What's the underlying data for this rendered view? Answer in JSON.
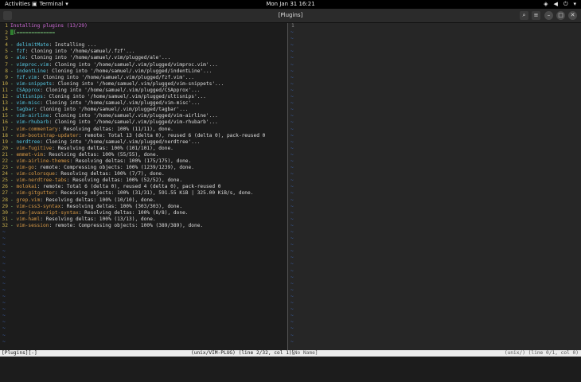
{
  "topbar": {
    "activities": "Activities",
    "app_name": "Terminal",
    "clock": "Mon Jan 31  16:21"
  },
  "window": {
    "title": "[Plugins]"
  },
  "left_pane": {
    "header": "Installing plugins (13/29)",
    "progress": "[=============",
    "lines": [
      {
        "n": "4",
        "name": "delimitMate",
        "text": ": Installing ..."
      },
      {
        "n": "5",
        "name": "fzf",
        "text": ": Cloning into '/home/samuel/.fzf'..."
      },
      {
        "n": "6",
        "name": "ale",
        "text": ": Cloning into '/home/samuel/.vim/plugged/ale'..."
      },
      {
        "n": "7",
        "name": "vimproc.vim",
        "text": ": Cloning into '/home/samuel/.vim/plugged/vimproc.vim'..."
      },
      {
        "n": "8",
        "name": "indentLine",
        "text": ": Cloning into '/home/samuel/.vim/plugged/indentLine'..."
      },
      {
        "n": "9",
        "name": "fzf.vim",
        "text": ": Cloning into '/home/samuel/.vim/plugged/fzf.vim'..."
      },
      {
        "n": "10",
        "name": "vim-snippets",
        "text": ": Cloning into '/home/samuel/.vim/plugged/vim-snippets'..."
      },
      {
        "n": "11",
        "name": "CSApprox",
        "text": ": Cloning into '/home/samuel/.vim/plugged/CSApprox'..."
      },
      {
        "n": "12",
        "name": "ultisnips",
        "text": ": Cloning into '/home/samuel/.vim/plugged/ultisnips'..."
      },
      {
        "n": "13",
        "name": "vim-misc",
        "text": ": Cloning into '/home/samuel/.vim/plugged/vim-misc'..."
      },
      {
        "n": "14",
        "name": "tagbar",
        "text": ": Cloning into '/home/samuel/.vim/plugged/tagbar'..."
      },
      {
        "n": "15",
        "name": "vim-airline",
        "text": ": Cloning into '/home/samuel/.vim/plugged/vim-airline'..."
      },
      {
        "n": "16",
        "name": "vim-rhubarb",
        "text": ": Cloning into '/home/samuel/.vim/plugged/vim-rhubarb'..."
      },
      {
        "n": "17",
        "name": "vim-commentary",
        "text": ": Resolving deltas: 100% (11/11), done.",
        "done": true
      },
      {
        "n": "18",
        "name": "vim-bootstrap-updater",
        "text": ": remote: Total 13 (delta 0), reused 6 (delta 0), pack-reused 0",
        "done": true
      },
      {
        "n": "19",
        "name": "nerdtree",
        "text": ": Cloning into '/home/samuel/.vim/plugged/nerdtree'..."
      },
      {
        "n": "20",
        "name": "vim-fugitive",
        "text": ": Resolving deltas: 100% (101/101), done.",
        "done": true
      },
      {
        "n": "21",
        "name": "emmet-vim",
        "text": ": Resolving deltas: 100% (55/55), done.",
        "done": true
      },
      {
        "n": "22",
        "name": "vim-airline-themes",
        "text": ": Resolving deltas: 100% (175/175), done.",
        "done": true
      },
      {
        "n": "23",
        "name": "vim-go",
        "text": ": remote: Compressing objects: 100% (1239/1239), done.",
        "done": true
      },
      {
        "n": "24",
        "name": "vim-colorsque",
        "text": ": Resolving deltas: 100% (7/7), done.",
        "done": true
      },
      {
        "n": "25",
        "name": "vim-nerdtree-tabs",
        "text": ": Resolving deltas: 100% (52/52), done.",
        "done": true
      },
      {
        "n": "26",
        "name": "molokai",
        "text": ": remote: Total 6 (delta 0), reused 4 (delta 0), pack-reused 0",
        "done": true
      },
      {
        "n": "27",
        "name": "vim-gitgutter",
        "text": ": Receiving objects: 100% (31/31), 591.55 KiB | 325.00 KiB/s, done.",
        "done": true
      },
      {
        "n": "28",
        "name": "grep.vim",
        "text": ": Resolving deltas: 100% (10/10), done.",
        "done": true
      },
      {
        "n": "29",
        "name": "vim-css3-syntax",
        "text": ": Resolving deltas: 100% (303/303), done.",
        "done": true
      },
      {
        "n": "30",
        "name": "vim-javascript-syntax",
        "text": ": Resolving deltas: 100% (8/8), done.",
        "done": true
      },
      {
        "n": "31",
        "name": "vim-haml",
        "text": ": Resolving deltas: 100% (13/13), done.",
        "done": true
      },
      {
        "n": "32",
        "name": "vim-session",
        "text": ": remote: Compressing objects: 100% (389/389), done.",
        "done": true
      }
    ]
  },
  "right_pane": {
    "line_number": "1"
  },
  "statusbar": {
    "left_buffer": "[Plugins][-]",
    "left_info": "(unix/VIM-PLUG) (line 2/32, col 1)\\",
    "right_buffer": "[No Name]",
    "right_info": "(unix/) (line 0/1, col 0)"
  }
}
